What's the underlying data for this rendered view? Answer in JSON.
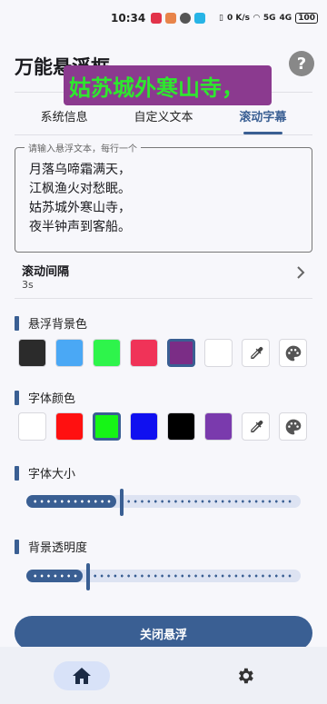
{
  "status_bar": {
    "time": "10:34",
    "net_speed": "0 K/s",
    "signal1": "5G",
    "signal2": "4G",
    "battery": "100"
  },
  "app": {
    "title": "万能悬浮框",
    "float_preview_text": "姑苏城外寒山寺，"
  },
  "tabs": [
    {
      "label": "系统信息"
    },
    {
      "label": "自定义文本"
    },
    {
      "label": "滚动字幕"
    }
  ],
  "text_input": {
    "label": "请输入悬浮文本，每行一个",
    "lines": [
      "月落乌啼霜满天，",
      "江枫渔火对愁眠。",
      "姑苏城外寒山寺，",
      "夜半钟声到客船。"
    ]
  },
  "interval": {
    "title": "滚动间隔",
    "value": "3s"
  },
  "bg_color": {
    "title": "悬浮背景色",
    "swatches": [
      "#2b2b2b",
      "#4aa8f5",
      "#2ef44b",
      "#f03358",
      "#7b2d86",
      "#ffffff"
    ],
    "selected_index": 4
  },
  "font_color": {
    "title": "字体颜色",
    "swatches": [
      "#ffffff",
      "#ff1010",
      "#16f516",
      "#1010f0",
      "#000000",
      "#7a3aad"
    ],
    "selected_index": 2
  },
  "font_size": {
    "title": "字体大小",
    "value_fraction": 0.34
  },
  "bg_opacity": {
    "title": "背景透明度",
    "value_fraction": 0.22
  },
  "close_button": {
    "label": "关闭悬浮"
  },
  "icons": {
    "help": "help-icon",
    "chevron": "chevron-right-icon",
    "eyedropper": "eyedropper-icon",
    "palette": "palette-icon",
    "home": "home-icon",
    "settings": "gear-icon"
  },
  "colors": {
    "accent": "#3a5f93"
  }
}
